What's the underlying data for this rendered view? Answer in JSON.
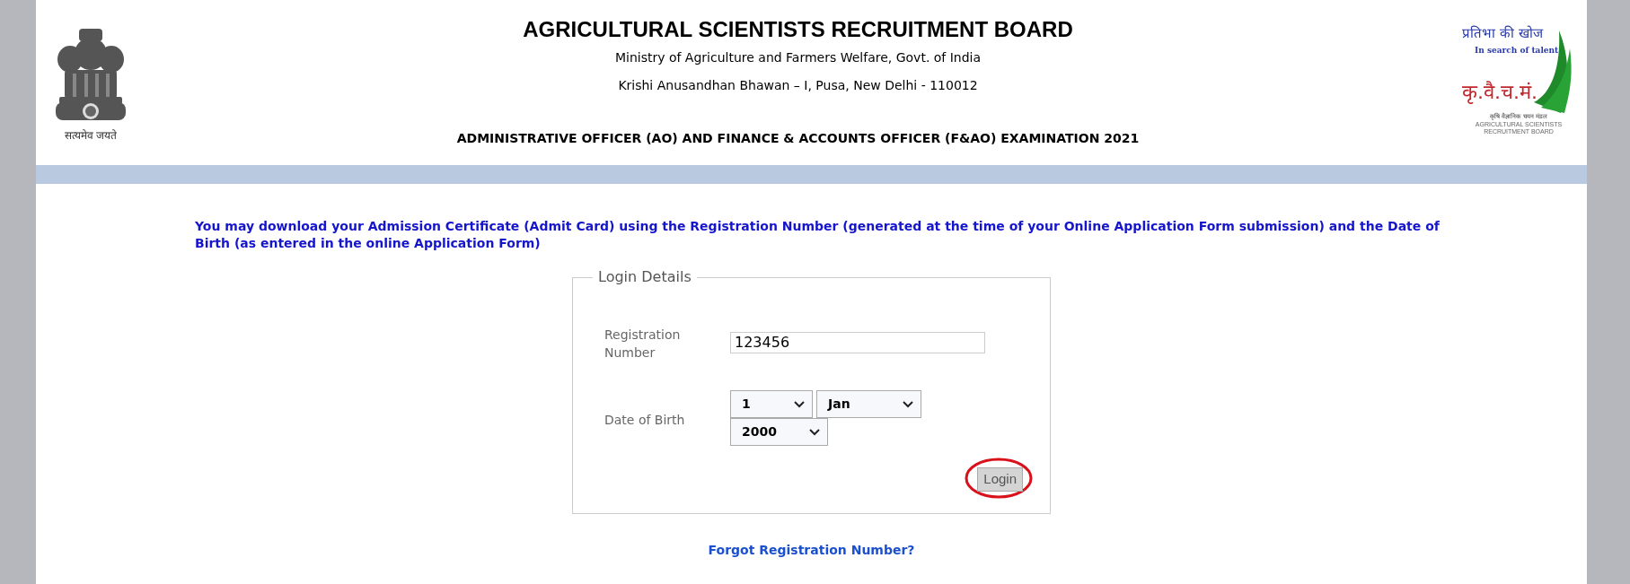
{
  "header": {
    "emblem_motto": "सत्यमेव जयते",
    "title": "AGRICULTURAL SCIENTISTS RECRUITMENT BOARD",
    "subtitle": "Ministry of Agriculture and Farmers Welfare, Govt. of India",
    "address": "Krishi Anusandhan Bhawan – I, Pusa, New Delhi - 110012",
    "exam_title": "ADMINISTRATIVE OFFICER (AO) AND FINANCE & ACCOUNTS OFFICER (F&AO) EXAMINATION 2021",
    "logo": {
      "hindi_tagline": "प्रतिभा की खोज",
      "english_tagline": "In search of talent",
      "acronym": "कृ.वै.च.मं.",
      "hindi_name": "कृषि वैज्ञानिक चयन मंडल",
      "english_name": "AGRICULTURAL SCIENTISTS RECRUITMENT BOARD"
    }
  },
  "instructions": "You may download your Admission Certificate (Admit Card) using the Registration Number (generated at the time of your Online Application Form submission) and the Date of Birth (as entered in the online Application Form)",
  "login": {
    "legend": "Login Details",
    "registration": {
      "label": "Registration Number",
      "value": "123456"
    },
    "dob": {
      "label": "Date of Birth",
      "selects": [
        {
          "kind": "day",
          "value": "1"
        },
        {
          "kind": "month",
          "value": "Jan"
        },
        {
          "kind": "year",
          "value": "2000"
        }
      ]
    },
    "button": {
      "label": "Login",
      "circled": true
    }
  },
  "forgot_link": "Forgot Registration Number?"
}
